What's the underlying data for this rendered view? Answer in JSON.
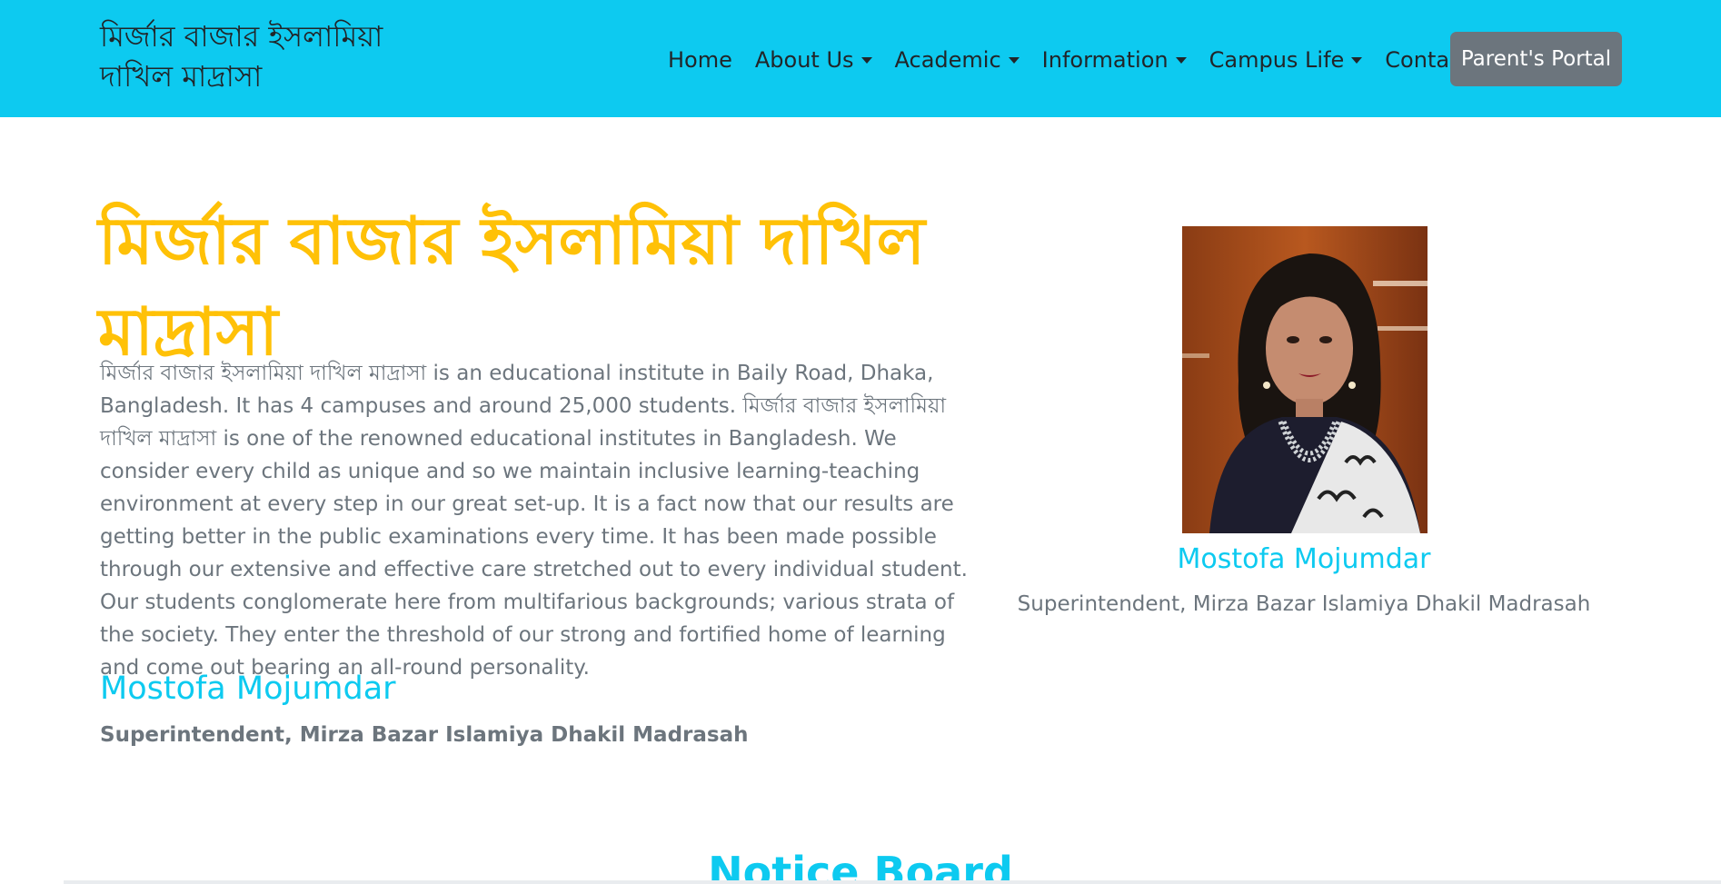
{
  "navbar": {
    "brand": "মির্জার বাজার ইসলামিয়া দাখিল মাদ্রাসা",
    "items": [
      {
        "label": "Home",
        "dropdown": false
      },
      {
        "label": "About Us",
        "dropdown": true
      },
      {
        "label": "Academic",
        "dropdown": true
      },
      {
        "label": "Information",
        "dropdown": true
      },
      {
        "label": "Campus Life",
        "dropdown": true
      },
      {
        "label": "Contact",
        "dropdown": false
      }
    ],
    "portal_button": "Parent's Portal",
    "bg_color": "#0dcaf0"
  },
  "hero": {
    "title": "মির্জার বাজার ইসলামিয়া দাখিল মাদ্রাসা",
    "description": "মির্জার বাজার ইসলামিয়া দাখিল মাদ্রাসা is an educational institute in Baily Road, Dhaka, Bangladesh. It has 4 campuses and around 25,000 students. মির্জার বাজার ইসলামিয়া দাখিল মাদ্রাসা is one of the renowned educational institutes in Bangladesh. We consider every child as unique and so we maintain inclusive learning-teaching environment at every step in our great set-up. It is a fact now that our results are getting better in the public examinations every time. It has been made possible through our extensive and effective care stretched out to every individual student. Our students conglomerate here from multifarious backgrounds; various strata of the society. They enter the threshold of our strong and fortified home of learning and come out bearing an all-round personality.",
    "signature_name": "Mostofa Mojumdar",
    "signature_role": "Superintendent, Mirza Bazar Islamiya Dhakil Madrasah",
    "title_color": "#ffc107"
  },
  "profile_card": {
    "name": "Mostofa Mojumdar",
    "role": "Superintendent, Mirza Bazar Islamiya Dhakil Madrasah"
  },
  "notice_board": {
    "title": "Notice Board"
  }
}
